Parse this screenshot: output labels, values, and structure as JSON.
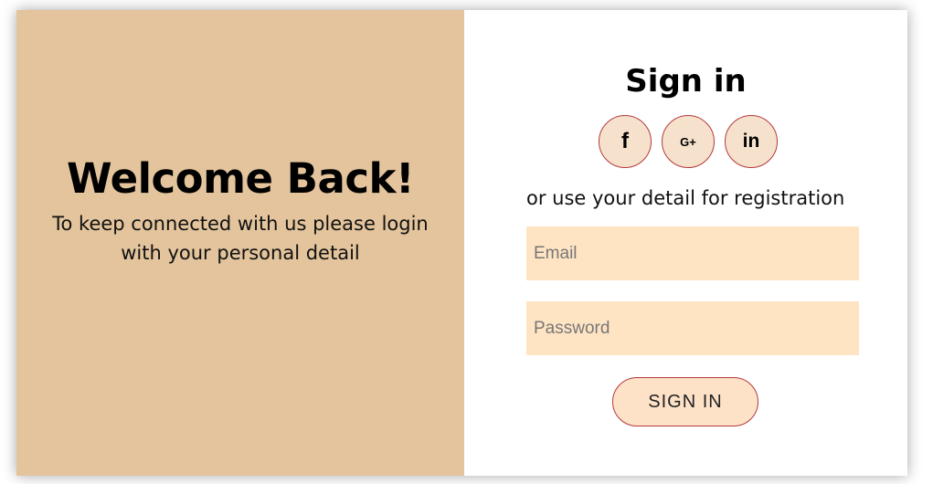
{
  "welcome": {
    "title": "Welcome Back!",
    "message": "To keep connected with us please login with your personal detail"
  },
  "signin": {
    "title": "Sign in",
    "social": [
      {
        "name": "facebook",
        "glyph": "f"
      },
      {
        "name": "google-plus",
        "glyph": "G+"
      },
      {
        "name": "linkedin",
        "glyph": "in"
      }
    ],
    "alt_text": "or use your detail for registration",
    "email_placeholder": "Email",
    "email_value": "",
    "password_placeholder": "Password",
    "password_value": "",
    "button_label": "SIGN IN"
  },
  "colors": {
    "left_panel": "#e3c49c",
    "input_bg": "#ffe4c4",
    "accent_border": "#b5383d",
    "social_bg": "#f6e2cc"
  }
}
